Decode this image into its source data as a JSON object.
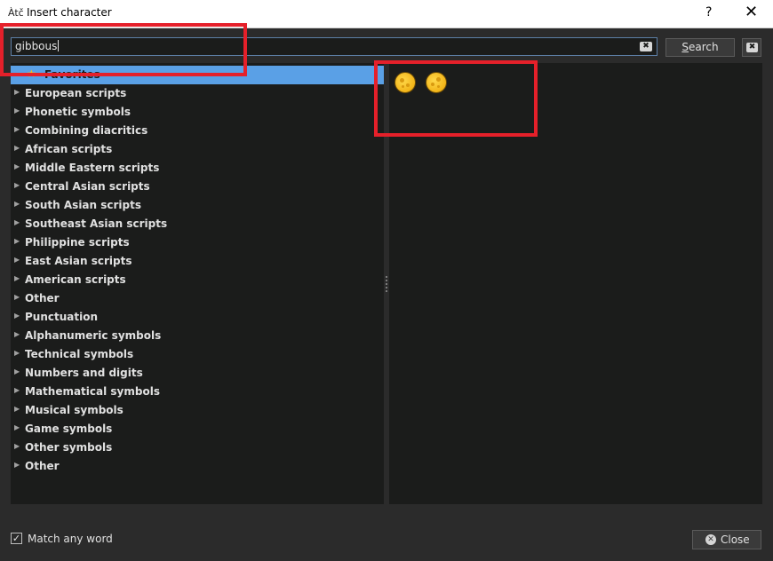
{
  "window": {
    "icon_text": "Àtč",
    "title": "Insert character",
    "help_label": "?",
    "close_glyph": "✕"
  },
  "search": {
    "value": "gibbous",
    "clear_glyph": "✖",
    "button_label": "Search",
    "button_accel": "S",
    "button_rest": "earch",
    "clear_button_glyph": "✖"
  },
  "tree": {
    "favorites_label": "Favorites",
    "items": [
      "European scripts",
      "Phonetic symbols",
      "Combining diacritics",
      "African scripts",
      "Middle Eastern scripts",
      "Central Asian scripts",
      "South Asian scripts",
      "Southeast Asian scripts",
      "Philippine scripts",
      "East Asian scripts",
      "American scripts",
      "Other",
      "Punctuation",
      "Alphanumeric symbols",
      "Technical symbols",
      "Numbers and digits",
      "Mathematical symbols",
      "Musical symbols",
      "Game symbols",
      "Other symbols",
      "Other"
    ]
  },
  "results": {
    "characters": [
      "waxing gibbous moon",
      "waning gibbous moon"
    ]
  },
  "footer": {
    "match_any_word_label": "Match any word",
    "match_any_word_checked": true,
    "check_glyph": "✓",
    "close_label": "Close",
    "close_icon_glyph": "✕"
  },
  "colors": {
    "selection": "#5aa0e6",
    "panel_bg": "#1b1c1b",
    "dialog_bg": "#2b2b2b",
    "annotation": "#e5202a"
  }
}
